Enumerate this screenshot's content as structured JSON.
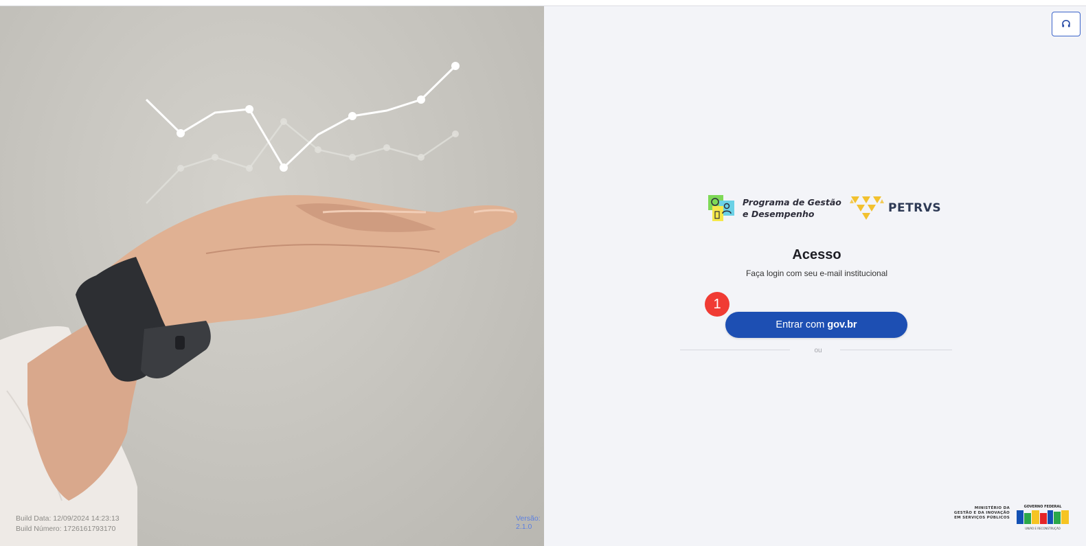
{
  "hero": {
    "build_date": "Build Data: 12/09/2024 14:23:13",
    "build_number": "Build Número: 1726161793170",
    "version": "Versão: 2.1.0"
  },
  "header": {
    "support_icon": "headset-icon"
  },
  "brand": {
    "program_line1": "Programa de Gestão",
    "program_line2": "e Desempenho",
    "product": "PETRVS"
  },
  "login": {
    "title": "Acesso",
    "subtitle": "Faça login com seu e-mail institucional",
    "button_prefix": "Entrar com",
    "button_brand": "gov.br",
    "separator": "ou"
  },
  "annotation": {
    "badge": "1"
  },
  "footer": {
    "ministry_line1": "MINISTÉRIO DA",
    "ministry_line2": "GESTÃO E DA INOVAÇÃO",
    "ministry_line3": "EM SERVIÇOS PÚBLICOS",
    "gov_top": "GOVERNO FEDERAL",
    "gov_main": "BRASIL",
    "gov_bottom": "UNIÃO E RECONSTRUÇÃO"
  },
  "colors": {
    "primary": "#1d4fb3",
    "badge": "#f03b34",
    "petrvs_yellow": "#f2c12e"
  }
}
